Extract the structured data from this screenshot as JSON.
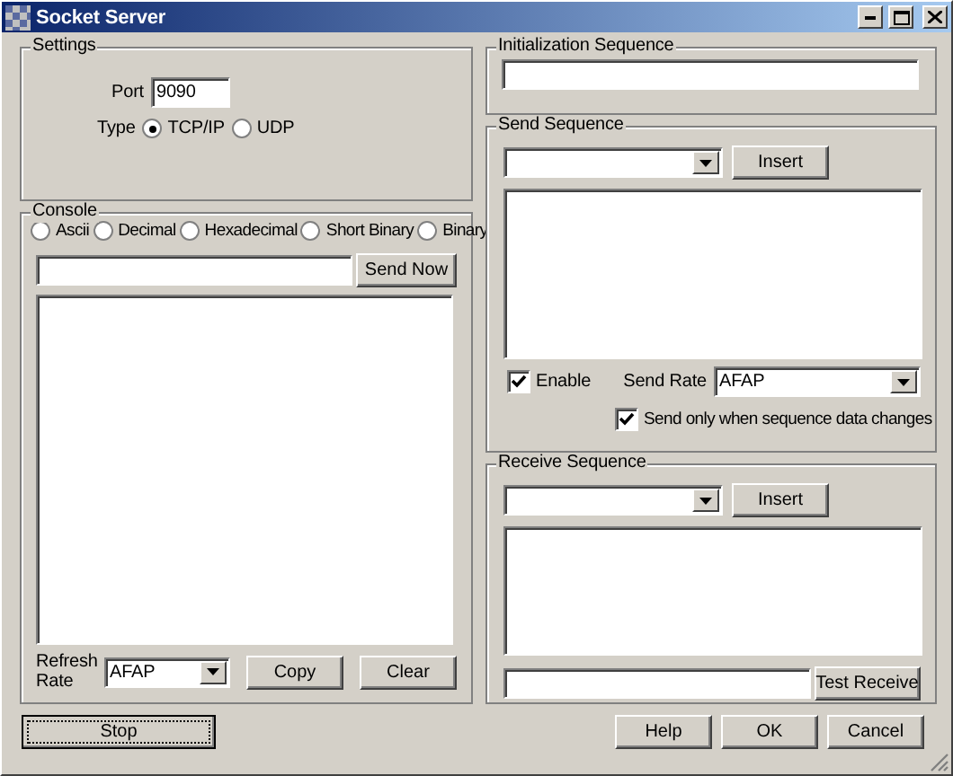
{
  "window": {
    "title": "Socket Server"
  },
  "settings": {
    "title": "Settings",
    "port_label": "Port",
    "port": "9090",
    "type_label": "Type",
    "types": [
      {
        "label": "TCP/IP",
        "selected": true
      },
      {
        "label": "UDP",
        "selected": false
      }
    ]
  },
  "console": {
    "title": "Console",
    "formats": [
      {
        "label": "Ascii",
        "selected": false
      },
      {
        "label": "Decimal",
        "selected": false
      },
      {
        "label": "Hexadecimal",
        "selected": false
      },
      {
        "label": "Short Binary",
        "selected": false
      },
      {
        "label": "Binary",
        "selected": false
      }
    ],
    "send_button": "Send Now",
    "refresh_label": "Refresh Rate",
    "refresh_rate": "AFAP",
    "buttons": [
      "Copy",
      "Clear"
    ]
  },
  "init_sequence": {
    "title": "Initialization Sequence"
  },
  "send_sequence": {
    "title": "Send Sequence",
    "insert_button": "Insert",
    "enable": {
      "label": "Enable",
      "checked": true
    },
    "send_rate_label": "Send Rate",
    "send_rate": "AFAP",
    "only_changes": {
      "label": "Send only when sequence data changes",
      "checked": true
    }
  },
  "receive_sequence": {
    "title": "Receive Sequence",
    "insert_button": "Insert",
    "test_button": "Test Receive"
  },
  "footer": {
    "stop_button": "Stop",
    "buttons": [
      "Help",
      "OK",
      "Cancel"
    ]
  }
}
